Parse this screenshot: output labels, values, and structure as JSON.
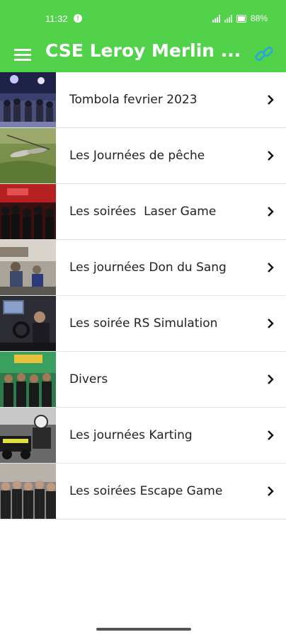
{
  "status_bar": {
    "time": "11:32",
    "notification_badge": "!",
    "battery": "88%"
  },
  "app_bar": {
    "title": "CSE Leroy Merlin ...",
    "menu_icon": "hamburger-menu-icon",
    "link_icon": "link-icon"
  },
  "colors": {
    "app_bar": "#52d14b",
    "text": "#222222",
    "divider": "#e4e4e4"
  },
  "items": [
    {
      "label": "Tombola fevrier 2023",
      "image": "event-crowd-photo"
    },
    {
      "label": "Les Journées de pêche",
      "image": "fishing-photo"
    },
    {
      "label": "Les soirées  Laser Game",
      "image": "laser-game-group-photo"
    },
    {
      "label": "Les journées Don du Sang",
      "image": "blood-donation-photo"
    },
    {
      "label": "Les soirée RS Simulation",
      "image": "racing-simulator-photo"
    },
    {
      "label": "Divers",
      "image": "group-photo"
    },
    {
      "label": "Les journées Karting",
      "image": "karting-photo"
    },
    {
      "label": "Les soirées Escape Game",
      "image": "escape-game-group-photo"
    }
  ]
}
